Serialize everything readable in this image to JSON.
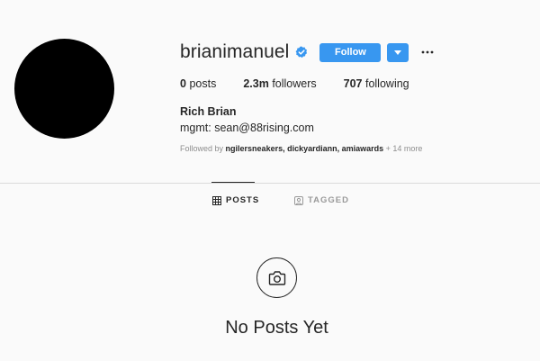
{
  "profile": {
    "username": "brianimanuel",
    "verified": true,
    "follow_label": "Follow",
    "dropdown_icon": "caret-down-icon",
    "more_icon": "ellipsis-icon",
    "full_name": "Rich Brian",
    "bio": "mgmt: sean@88rising.com",
    "avatar_color": "#000000"
  },
  "stats": {
    "posts_count": "0",
    "posts_label": "posts",
    "followers_count": "2.3m",
    "followers_label": "followers",
    "following_count": "707",
    "following_label": "following"
  },
  "followed_by": {
    "prefix": "Followed by",
    "names": "ngilersneakers, dickyardiann, amiawards",
    "more": "+ 14 more"
  },
  "tabs": [
    {
      "label": "POSTS",
      "icon": "grid-icon",
      "active": true
    },
    {
      "label": "TAGGED",
      "icon": "tag-user-icon",
      "active": false
    }
  ],
  "empty_state": {
    "icon": "camera-icon",
    "message": "No Posts Yet"
  },
  "colors": {
    "accent": "#3897f0",
    "background": "#fafafa",
    "text": "#262626",
    "muted": "#8e8e8e"
  }
}
